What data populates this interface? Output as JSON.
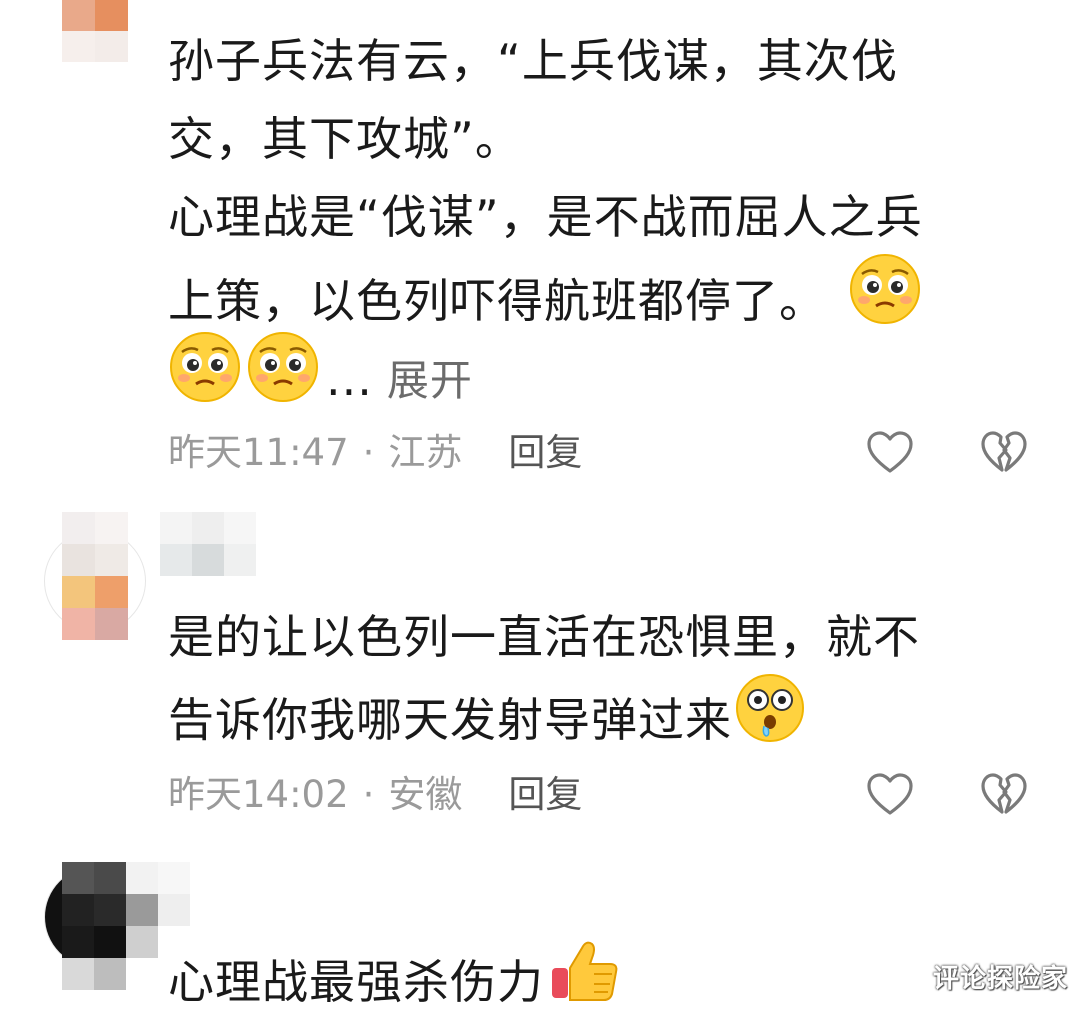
{
  "comments": [
    {
      "lines": [
        "孙子兵法有云，“上兵伐谋，其次伐",
        "交，其下攻城”。",
        "心理战是“伐谋”，是不战而屈人之兵",
        "上策，以色列吓得航班都停了。"
      ],
      "ellipsis": "...",
      "expand_label": "展开",
      "emojis": [
        "pleading-face-emoji",
        "pleading-face-emoji",
        "pleading-face-emoji"
      ],
      "time": "昨天11:47",
      "location": "江苏",
      "reply_label": "回复"
    },
    {
      "lines": [
        "是的让以色列一直活在恐惧里，就不",
        "告诉你我哪天发射导弹过来"
      ],
      "emojis": [
        "drooling-face-emoji"
      ],
      "time": "昨天14:02",
      "location": "安徽",
      "reply_label": "回复"
    },
    {
      "lines": [
        "心理战最强杀伤力"
      ],
      "emojis": [
        "thumbs-up-emoji"
      ]
    }
  ],
  "separator": "·",
  "icons": {
    "like": "heart-outline-icon",
    "dislike": "broken-heart-outline-icon"
  },
  "colors": {
    "text": "#1a1a1a",
    "meta": "#9a9a9a",
    "icon": "#7a7a7a",
    "emoji_face": "#ffd23f"
  },
  "watermark": "评论探险家"
}
